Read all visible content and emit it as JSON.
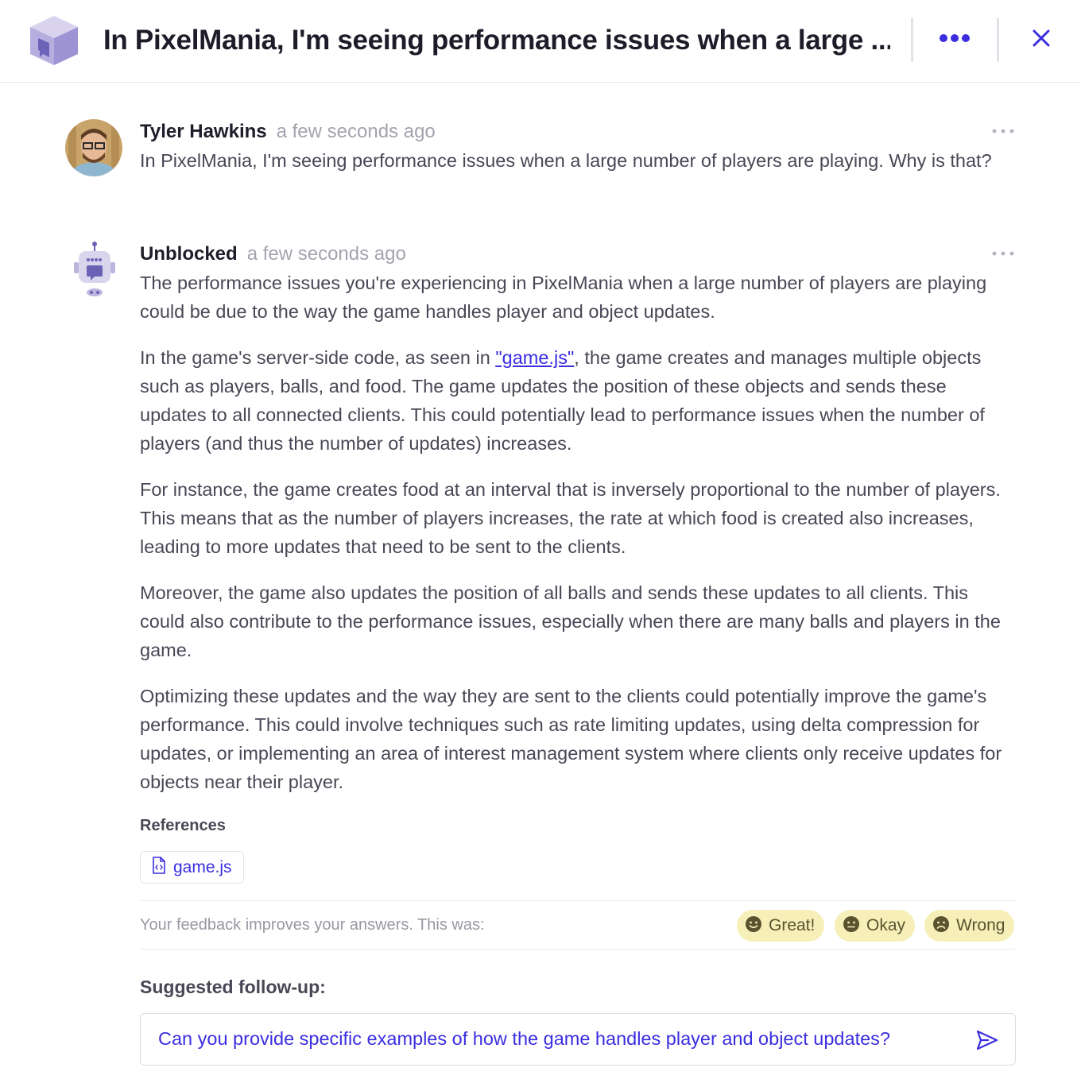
{
  "header": {
    "title": "In PixelMania, I'm seeing performance issues when a large ...",
    "logo_icon": "cube-logo-icon",
    "more_icon": "more-horizontal-icon",
    "close_icon": "close-icon",
    "accent": "#3a2ee0"
  },
  "question": {
    "author": "Tyler Hawkins",
    "time": "a few seconds ago",
    "text": "In PixelMania, I'm seeing performance issues when a large number of players are playing. Why is that?"
  },
  "answer": {
    "author": "Unblocked",
    "time": "a few seconds ago",
    "p1": "The performance issues you're experiencing in PixelMania when a large number of players are playing could be due to the way the game handles player and object updates.",
    "p2_before": "In the game's server-side code, as seen in ",
    "p2_link": "\"game.js\"",
    "p2_after": ", the game creates and manages multiple objects such as players, balls, and food. The game updates the position of these objects and sends these updates to all connected clients. This could potentially lead to performance issues when the number of players (and thus the number of updates) increases.",
    "p3": "For instance, the game creates food at an interval that is inversely proportional to the number of players. This means that as the number of players increases, the rate at which food is created also increases, leading to more updates that need to be sent to the clients.",
    "p4": "Moreover, the game also updates the position of all balls and sends these updates to all clients. This could also contribute to the performance issues, especially when there are many balls and players in the game.",
    "p5": "Optimizing these updates and the way they are sent to the clients could potentially improve the game's performance. This could involve techniques such as rate limiting updates, using delta compression for updates, or implementing an area of interest management system where clients only receive updates for objects near their player."
  },
  "references": {
    "title": "References",
    "items": [
      {
        "label": "game.js",
        "icon": "code-file-icon"
      }
    ]
  },
  "feedback": {
    "prompt": "Your feedback improves your answers. This was:",
    "great": "Great!",
    "okay": "Okay",
    "wrong": "Wrong",
    "chip_color": "#f7efb8"
  },
  "suggested": {
    "title": "Suggested follow-up:",
    "text": "Can you provide specific examples of how the game handles player and object updates?",
    "send_icon": "send-icon"
  }
}
